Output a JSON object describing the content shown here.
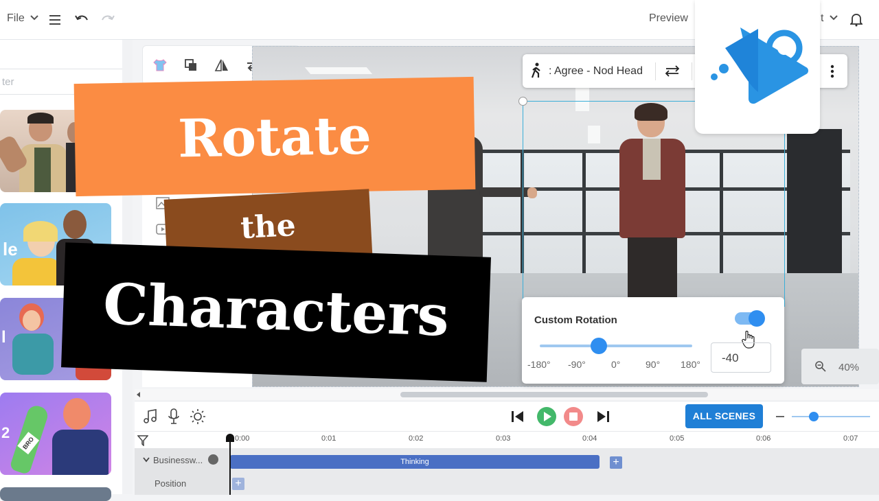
{
  "topbar": {
    "file_label": "File",
    "preview_label": "Preview",
    "export_partial": "t"
  },
  "left_panel": {
    "filter_placeholder": "ter",
    "thumb2_partial_text": "le",
    "thumb3_partial_text": "l",
    "thumb4_partial_text": "2",
    "bottle_label": "BRO"
  },
  "action_popup": {
    "label": ": Agree - Nod Head"
  },
  "rotation": {
    "title": "Custom Rotation",
    "enabled": true,
    "value": "-40",
    "value_number": -40,
    "min": -180,
    "max": 180,
    "ticks": [
      "-180°",
      "-90°",
      "0°",
      "90°",
      "180°"
    ]
  },
  "zoom": {
    "level": "40%"
  },
  "controls": {
    "all_scenes_label": "ALL SCENES"
  },
  "timeline": {
    "ticks": [
      "0:00",
      "0:01",
      "0:02",
      "0:03",
      "0:04",
      "0:05",
      "0:06",
      "0:07"
    ],
    "track_label": "Businessw...",
    "clip_label": "Thinking",
    "position_label": "Position",
    "add_symbol": "+"
  },
  "banners": {
    "line1": "Rotate",
    "line2": "the",
    "line3": "Characters"
  },
  "colors": {
    "accent": "#1f7fd6",
    "orange_banner": "#fb8c43",
    "brown_banner": "#8a4b1e",
    "toggle": "#2f8ef0",
    "play": "#43b86a",
    "stop": "#f28a8a",
    "clip": "#4a6fc4"
  }
}
